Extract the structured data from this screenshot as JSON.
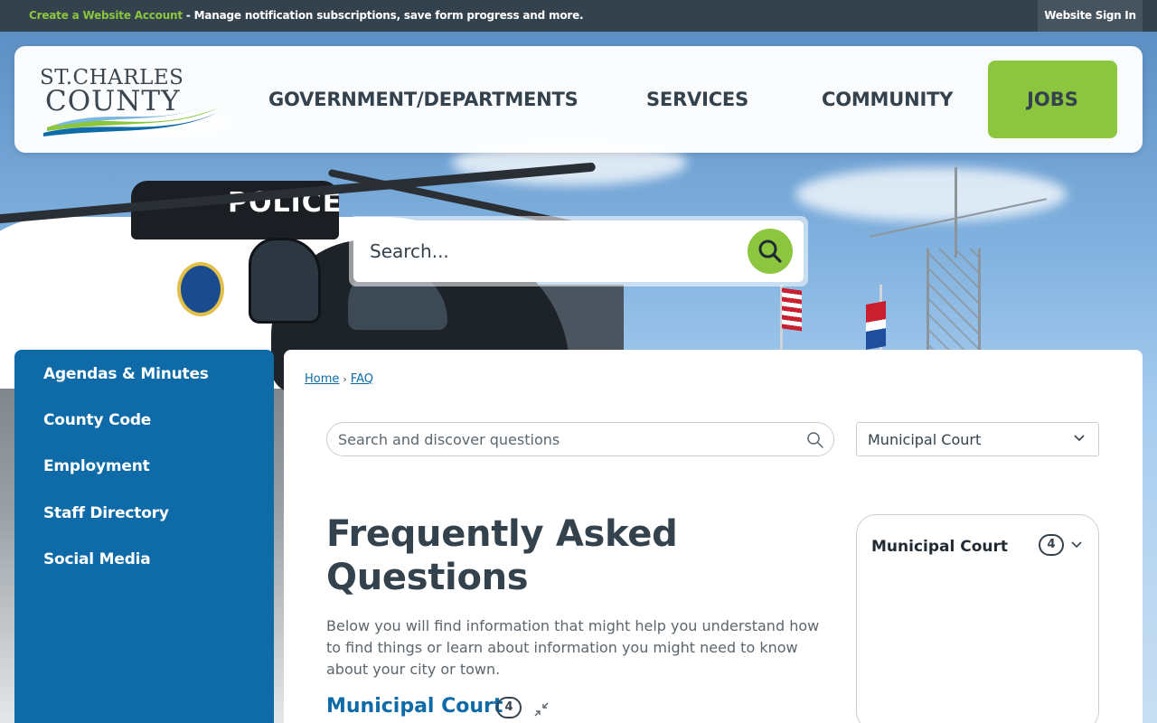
{
  "topbar": {
    "create_account": "Create a Website Account",
    "message": " - Manage notification subscriptions, save form progress and more.",
    "sign_in": "Website Sign In"
  },
  "header": {
    "logo_line1": "ST.CHARLES",
    "logo_line2": "COUNTY",
    "nav": [
      "GOVERNMENT/DEPARTMENTS",
      "SERVICES",
      "COMMUNITY"
    ],
    "jobs": "JOBS"
  },
  "hero": {
    "police_label": "POLICE",
    "search_placeholder": "Search..."
  },
  "sidebar": {
    "items": [
      "Agendas & Minutes",
      "County Code",
      "Employment",
      "Staff Directory",
      "Social Media"
    ]
  },
  "breadcrumb": {
    "home": "Home",
    "separator": "›",
    "current": "FAQ"
  },
  "faq": {
    "search_placeholder": "Search and discover questions",
    "category_select": "Municipal Court",
    "title": "Frequently Asked Questions",
    "description": "Below you will find information that might help you understand how to find things or learn about information you might need to know about your city or town.",
    "category_heading": "Municipal Court",
    "category_count": "4"
  },
  "side_card": {
    "title": "Municipal Court",
    "count": "4"
  },
  "colors": {
    "topbar": "#33424d",
    "accent_green": "#8cc63f",
    "primary_blue": "#0e6ba8",
    "text_dark": "#33424d"
  },
  "icons": {
    "hero_search": "search-icon",
    "faq_search": "search-icon",
    "select_chevron": "chevron-down-icon",
    "collapse": "collapse-icon"
  }
}
